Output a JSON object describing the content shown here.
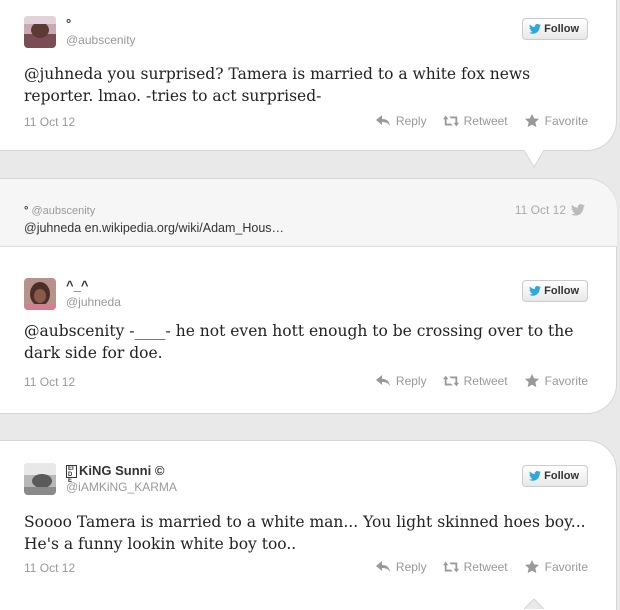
{
  "follow_label": "Follow",
  "actions": {
    "reply": "Reply",
    "retweet": "Retweet",
    "favorite": "Favorite"
  },
  "tweets": [
    {
      "name": "°",
      "handle": "@aubscenity",
      "text": "@juhneda you surprised? Tamera is married to a white fox news reporter. lmao. -tries to act surprised-",
      "date": "11 Oct 12"
    },
    {
      "name": "^_^",
      "handle": "@juhneda",
      "text": "@aubscenity -____- he not even hott enough to be crossing over to the dark side for doe.",
      "date": "11 Oct 12"
    },
    {
      "name": "KiNG Sunni ©",
      "badge": "EI DE",
      "handle": "@iAMKiNG_KARMA",
      "text": "Soooo Tamera is married to a white man... You light skinned hoes boy... He's a funny lookin white boy too..",
      "date": "11 Oct 12"
    }
  ],
  "context": {
    "name": "°",
    "handle": "@aubscenity",
    "text": "@juhneda en.wikipedia.org/wiki/Adam_Hous…",
    "date": "11 Oct 12"
  },
  "colors": {
    "twitter_blue": "#2aa9e0",
    "muted": "#999999"
  }
}
